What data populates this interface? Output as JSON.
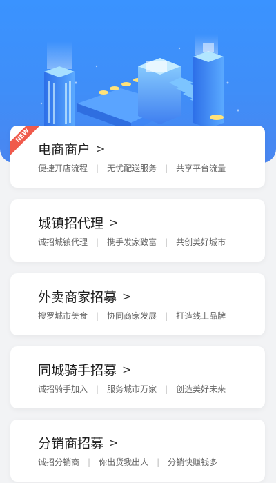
{
  "cards": [
    {
      "title": "电商商户",
      "badge": "NEW",
      "tags": [
        "便捷开店流程",
        "无忧配送服务",
        "共享平台流量"
      ]
    },
    {
      "title": "城镇招代理",
      "tags": [
        "诚招城镇代理",
        "携手发家致富",
        "共创美好城市"
      ]
    },
    {
      "title": "外卖商家招募",
      "tags": [
        "搜罗城市美食",
        "协同商家发展",
        "打造线上品牌"
      ]
    },
    {
      "title": "同城骑手招募",
      "tags": [
        "诚招骑手加入",
        "服务城市万家",
        "创造美好未来"
      ]
    },
    {
      "title": "分销商招募",
      "tags": [
        "诚招分销商",
        "你出货我出人",
        "分销快赚钱多"
      ]
    }
  ],
  "chevron": ">",
  "separator": "|",
  "colors": {
    "hero": "#3a93ff",
    "badge": "#f05a4c",
    "card_bg": "#ffffff",
    "page_bg": "#f2f3f5"
  }
}
